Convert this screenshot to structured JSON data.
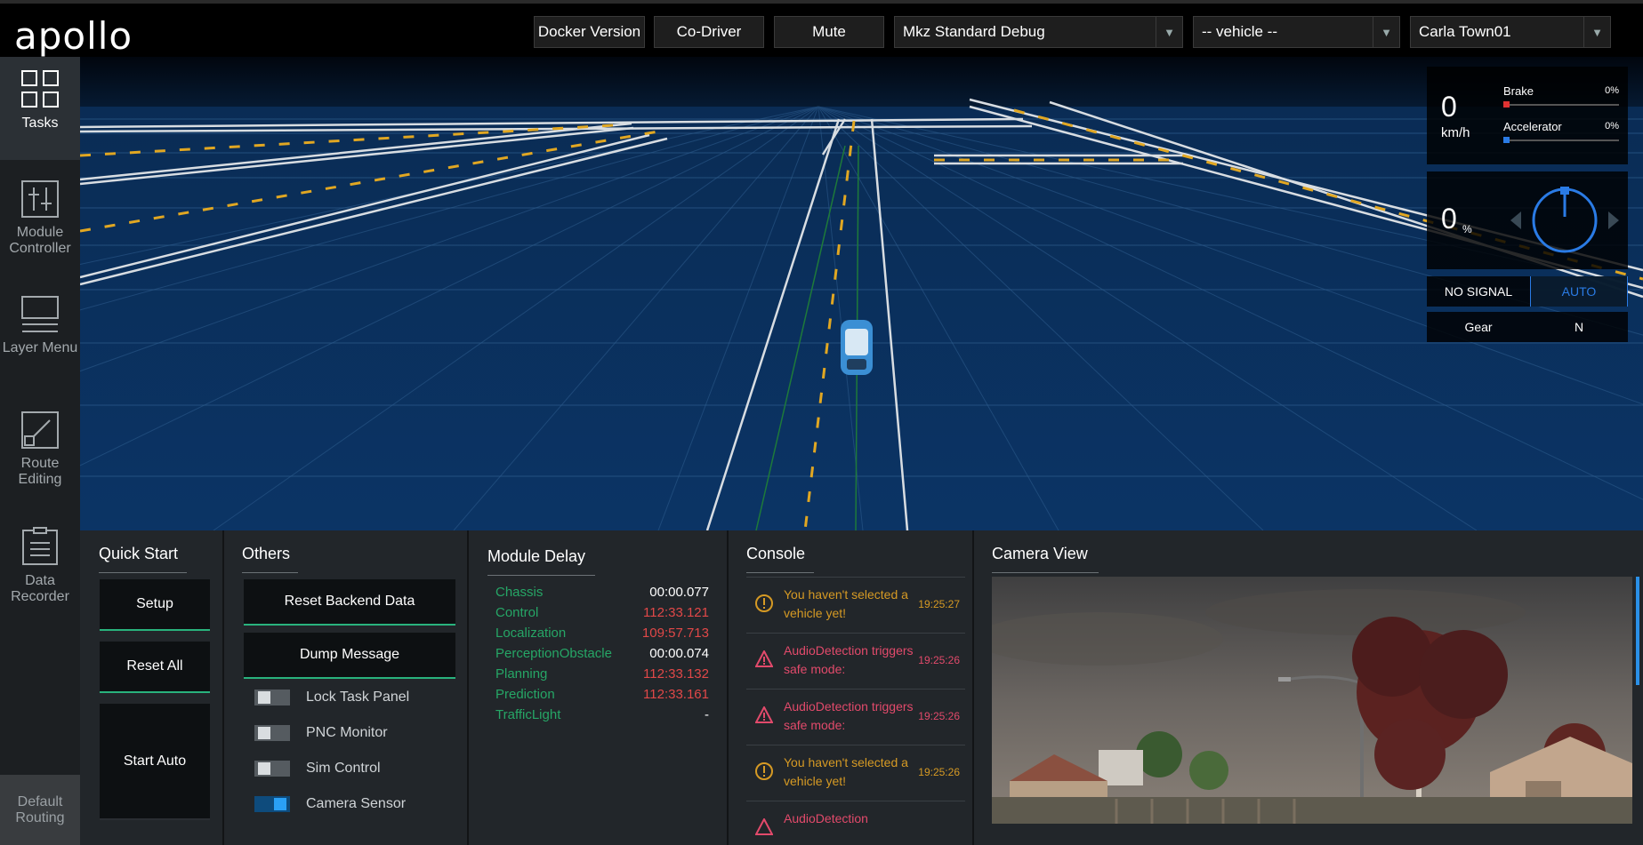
{
  "header": {
    "logo": "apollo",
    "buttons": {
      "docker": "Docker Version",
      "codriver": "Co-Driver",
      "mute": "Mute"
    },
    "selects": {
      "mode": "Mkz Standard Debug",
      "vehicle": "-- vehicle --",
      "map": "Carla Town01"
    }
  },
  "sidebar": {
    "items": [
      {
        "label": "Tasks",
        "icon": "grid-icon"
      },
      {
        "label": "Module Controller",
        "icon": "sliders-icon"
      },
      {
        "label": "Layer Menu",
        "icon": "layers-icon"
      },
      {
        "label": "Route Editing",
        "icon": "route-icon"
      },
      {
        "label": "Data Recorder",
        "icon": "clipboard-icon"
      }
    ],
    "default_routing": "Default Routing"
  },
  "dashboard": {
    "speed": "0",
    "speed_unit": "km/h",
    "brake_label": "Brake",
    "brake_value": "0%",
    "accel_label": "Accelerator",
    "accel_value": "0%",
    "steering": "0",
    "steering_unit": "%",
    "signal": "NO SIGNAL",
    "drive_mode": "AUTO",
    "gear_label": "Gear",
    "gear_value": "N",
    "colors": {
      "brake": "#e03232",
      "accel": "#2a7be5",
      "auto": "#2a7be5"
    }
  },
  "quick_start": {
    "title": "Quick Start",
    "buttons": [
      "Setup",
      "Reset All",
      "Start Auto"
    ]
  },
  "others": {
    "title": "Others",
    "buttons": [
      "Reset Backend Data",
      "Dump Message"
    ],
    "toggles": [
      {
        "label": "Lock Task Panel",
        "on": false
      },
      {
        "label": "PNC Monitor",
        "on": false
      },
      {
        "label": "Sim Control",
        "on": false
      },
      {
        "label": "Camera Sensor",
        "on": true
      }
    ]
  },
  "module_delay": {
    "title": "Module Delay",
    "rows": [
      {
        "name": "Chassis",
        "value": "00:00.077",
        "bad": false
      },
      {
        "name": "Control",
        "value": "112:33.121",
        "bad": true
      },
      {
        "name": "Localization",
        "value": "109:57.713",
        "bad": true
      },
      {
        "name": "PerceptionObstacle",
        "value": "00:00.074",
        "bad": false
      },
      {
        "name": "Planning",
        "value": "112:33.132",
        "bad": true
      },
      {
        "name": "Prediction",
        "value": "112:33.161",
        "bad": true
      },
      {
        "name": "TrafficLight",
        "value": "-",
        "bad": false
      }
    ]
  },
  "console": {
    "title": "Console",
    "rows": [
      {
        "level": "warn",
        "text": "You haven't selected a vehicle yet!",
        "time": "19:25:27"
      },
      {
        "level": "error",
        "text": "AudioDetection triggers safe mode:",
        "time": "19:25:26"
      },
      {
        "level": "error",
        "text": "AudioDetection triggers safe mode:",
        "time": "19:25:26"
      },
      {
        "level": "warn",
        "text": "You haven't selected a vehicle yet!",
        "time": "19:25:26"
      },
      {
        "level": "error",
        "text": "AudioDetection",
        "time": ""
      }
    ]
  },
  "camera": {
    "title": "Camera View"
  }
}
